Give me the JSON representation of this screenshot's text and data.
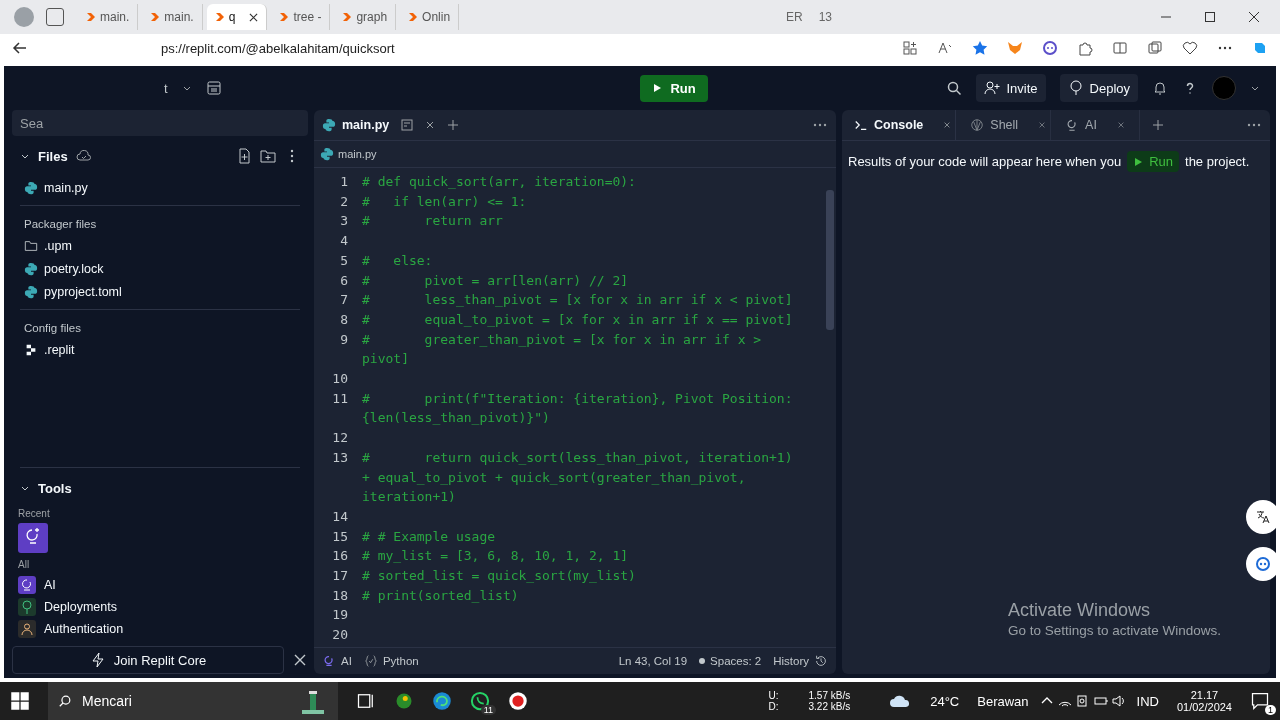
{
  "browser": {
    "tabs": [
      {
        "label": "main.",
        "selected": false
      },
      {
        "label": "main.",
        "selected": false
      },
      {
        "label": "q",
        "selected": true
      },
      {
        "label": "tree -",
        "selected": false
      },
      {
        "label": "graph",
        "selected": false
      },
      {
        "label": "Onlin",
        "selected": false
      }
    ],
    "tabs_tail": [
      "ER",
      "13"
    ],
    "address": "ps://replit.com/@abelkalahitam/quicksort"
  },
  "header": {
    "project": "t",
    "run": "Run",
    "invite": "Invite",
    "deploy": "Deploy"
  },
  "sidebar": {
    "search_placeholder": "Sea",
    "files_title": "Files",
    "files": [
      {
        "name": "main.py",
        "kind": "python"
      }
    ],
    "sections": [
      {
        "title": "Packager files",
        "files": [
          {
            "name": ".upm",
            "kind": "folder"
          },
          {
            "name": "poetry.lock",
            "kind": "python"
          },
          {
            "name": "pyproject.toml",
            "kind": "python"
          }
        ]
      },
      {
        "title": "Config files",
        "files": [
          {
            "name": ".replit",
            "kind": "config"
          }
        ]
      }
    ],
    "tools_title": "Tools",
    "recent_label": "Recent",
    "all_label": "All",
    "tools": [
      {
        "name": "AI",
        "kind": "ai"
      },
      {
        "name": "Deployments",
        "kind": "deploy"
      },
      {
        "name": "Authentication",
        "kind": "auth"
      }
    ],
    "join": "Join Replit Core"
  },
  "editor": {
    "tab": "main.py",
    "breadcrumb": "main.py",
    "lines": [
      {
        "n": "1",
        "code": "# def quick_sort(arr, iteration=0):"
      },
      {
        "n": "2",
        "code": "#   if len(arr) <= 1:"
      },
      {
        "n": "3",
        "code": "#       return arr"
      },
      {
        "n": "4"
      },
      {
        "n": "5",
        "code": "#   else:"
      },
      {
        "n": "6",
        "code": "#       pivot = arr[len(arr) // 2]"
      },
      {
        "n": "7",
        "code": "#       less_than_pivot = [x for x in arr if x < pivot]"
      },
      {
        "n": "8",
        "code": "#       equal_to_pivot = [x for x in arr if x == pivot]"
      },
      {
        "n": "9",
        "code": "#       greater_than_pivot = [x for x in arr if x > pivot]"
      },
      {
        "n": "10"
      },
      {
        "n": "11",
        "code": "#       print(f\"Iteration: {iteration}, Pivot Position: {len(less_than_pivot)}\")"
      },
      {
        "n": "12"
      },
      {
        "n": "13",
        "code": "#       return quick_sort(less_than_pivot, iteration+1) + equal_to_pivot + quick_sort(greater_than_pivot, iteration+1)"
      },
      {
        "n": "14"
      },
      {
        "n": "15",
        "code": "# # Example usage"
      },
      {
        "n": "16",
        "code": "# my_list = [3, 6, 8, 10, 1, 2, 1]"
      },
      {
        "n": "17",
        "code": "# sorted_list = quick_sort(my_list)"
      },
      {
        "n": "18",
        "code": "# print(sorted_list)"
      },
      {
        "n": "19"
      },
      {
        "n": "20"
      }
    ],
    "status": {
      "ai": "AI",
      "language": "Python",
      "position": "Ln 43, Col 19",
      "spaces": "Spaces: 2",
      "history": "History"
    }
  },
  "console": {
    "tabs": [
      {
        "label": "Console",
        "kind": "console",
        "selected": true
      },
      {
        "label": "Shell",
        "kind": "shell",
        "selected": false
      },
      {
        "label": "AI",
        "kind": "ai",
        "selected": false
      }
    ],
    "message_before": "Results of your code will appear here when you",
    "run": "Run",
    "message_after": "the project."
  },
  "activation": {
    "title": "Activate Windows",
    "subtitle": "Go to Settings to activate Windows."
  },
  "taskbar": {
    "search": "Mencari",
    "upload": "U:",
    "download": "D:",
    "upload_rate": "1.57 kB/s",
    "download_rate": "3.22 kB/s",
    "weather": "24°C",
    "condition": "Berawan",
    "language": "IND",
    "time": "21.17",
    "date": "01/02/2024",
    "whatsapp_badge": "11",
    "notification_badge": "1"
  }
}
